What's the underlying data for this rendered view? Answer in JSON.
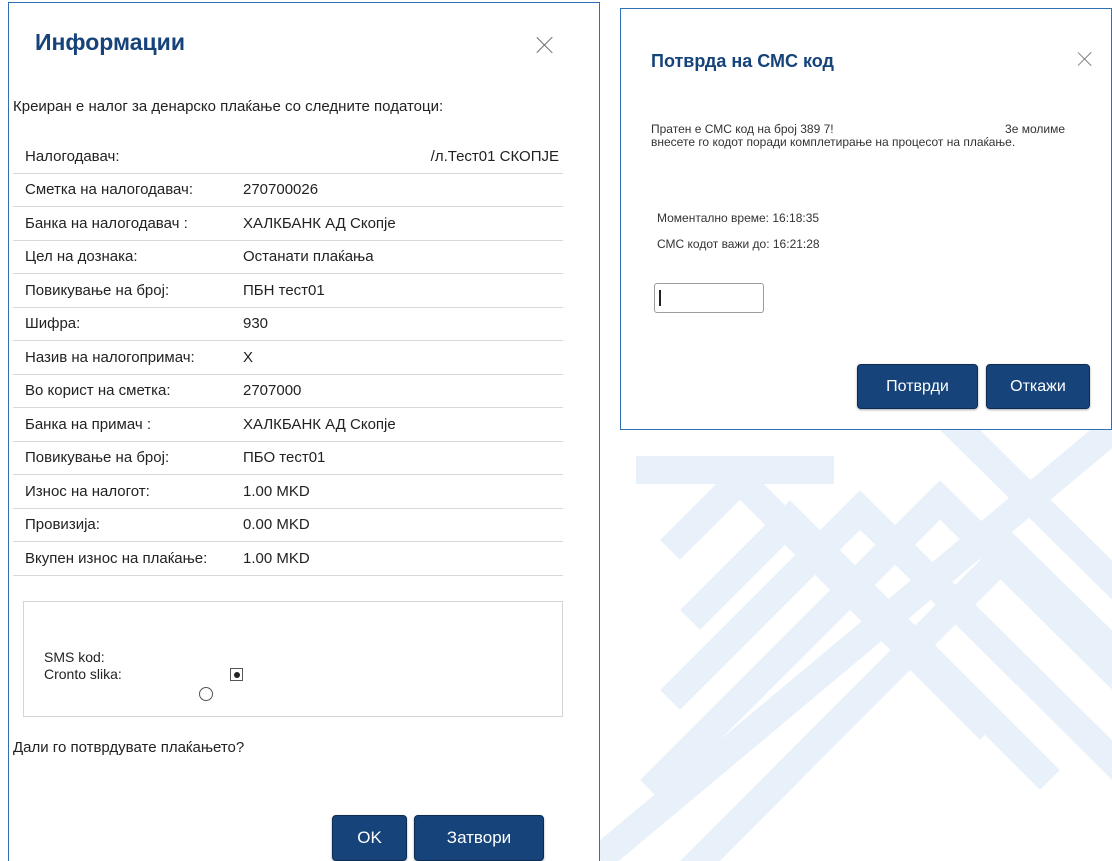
{
  "info_dialog": {
    "title": "Информации",
    "intro": "Креиран е налог за денарско плаќање со следните податоци:",
    "rows": [
      {
        "label": "Налогодавач:",
        "value": "/л.Тест01 СКОПЈЕ"
      },
      {
        "label": "Сметка на налогодавач:",
        "value": "270700026"
      },
      {
        "label": "Банка на налогодавач :",
        "value": "ХАЛКБАНК АД Скопје"
      },
      {
        "label": "Цел на дознака:",
        "value": "Останати плаќања"
      },
      {
        "label": "Повикување на број:",
        "value": "ПБН тест01"
      },
      {
        "label": "Шифра:",
        "value": "930"
      },
      {
        "label": "Назив на налогопримач:",
        "value": "X"
      },
      {
        "label": "Во корист на сметка:",
        "value": "2707000"
      },
      {
        "label": "Банка на примач :",
        "value": "ХАЛКБАНК АД Скопје"
      },
      {
        "label": "Повикување на број:",
        "value": "ПБО тест01"
      },
      {
        "label": "Износ на налогот:",
        "value": "1.00 MKD"
      },
      {
        "label": "Провизија:",
        "value": "0.00 MKD"
      },
      {
        "label": "Вкупен износ на плаќање:",
        "value": "1.00 MKD"
      }
    ],
    "auth": {
      "sms_label": "SMS kod:",
      "cronto_label": "Cronto slika:",
      "selected": "sms"
    },
    "question": "Дали го потврдувате плаќањето?",
    "ok_label": "OK",
    "close_label": "Затвори"
  },
  "sms_dialog": {
    "title": "Потврда на СМС код",
    "message_start": "Пратен е СМС код на број 389 7!",
    "message_mid": "3е молиме",
    "message_rest": "внесете го кодот поради комплетирање на процесот на плаќање.",
    "current_time": "Моментално време: 16:18:35",
    "valid_until": "СМС кодот важи до: 16:21:28",
    "code_value": "",
    "confirm_label": "Потврди",
    "cancel_label": "Откажи"
  },
  "colors": {
    "primary": "#15437a",
    "border": "#2f6fb3",
    "stripe": "#e7f0fa"
  },
  "icons": {
    "close": "close-icon"
  }
}
